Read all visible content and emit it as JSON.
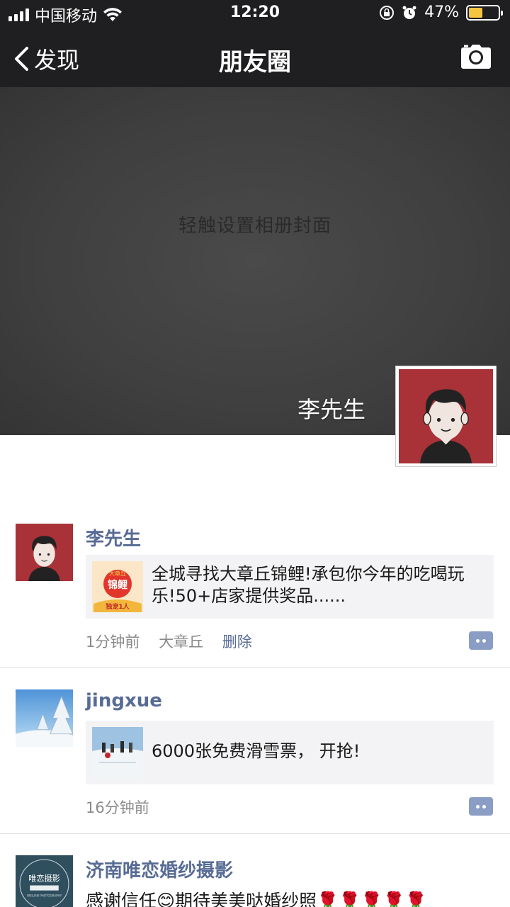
{
  "status_bar": {
    "carrier": "中国移动",
    "time": "12:20",
    "battery": "47%",
    "battery_level": 0.47,
    "icons": [
      "signal-icon",
      "wifi-icon",
      "rotation-lock-icon",
      "alarm-icon",
      "battery-icon"
    ]
  },
  "nav": {
    "back_label": "发现",
    "title": "朋友圈",
    "right_icon": "camera-icon"
  },
  "cover": {
    "hint": "轻触设置相册封面",
    "user_name": "李先生"
  },
  "posts": [
    {
      "name": "李先生",
      "share_text": "全城寻找大章丘锦鲤!承包你今年的吃喝玩乐!50+店家提供奖品......",
      "thumb_text_1": "大章丘",
      "thumb_text_2": "锦鲤",
      "thumb_text_3": "独宠1人",
      "time": "1分钟前",
      "location": "大章丘",
      "delete_label": "删除"
    },
    {
      "name": "jingxue",
      "share_text": "6000张免费滑雪票， 开抢!",
      "time": "16分钟前"
    },
    {
      "name": "济南唯恋婚纱摄影",
      "avatar_text": "唯恋摄影",
      "avatar_sub": "WEILIAN PHOTOGRAPHY",
      "text": "感谢信任😊期待美美哒婚纱照🌹🌹🌹🌹🌹"
    }
  ],
  "colors": {
    "bar_bg": "#1f1f21",
    "link": "#576b95",
    "share_bg": "#f3f3f5",
    "avatar_red": "#a83238"
  }
}
